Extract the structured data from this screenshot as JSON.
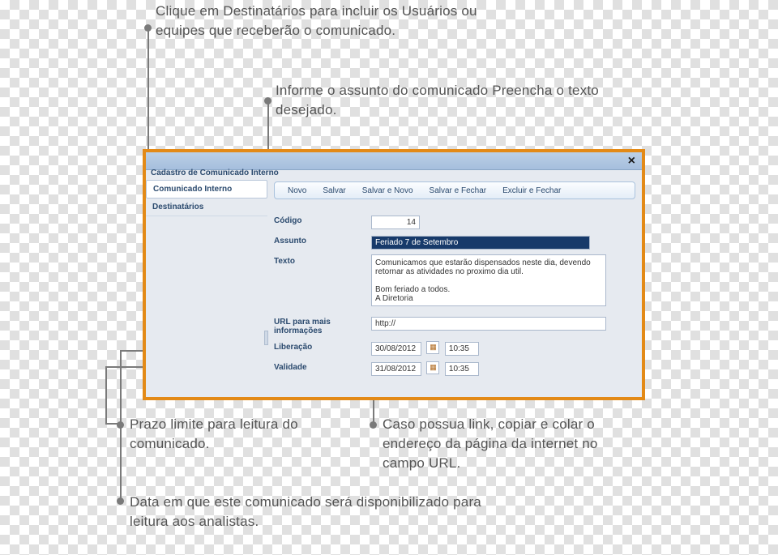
{
  "callouts": {
    "top1": "Clique em Destinatários para incluir os Usuários ou equipes que receberão o comunicado.",
    "top2": "Informe o assunto do comunicado Preencha o texto desejado.",
    "bottom_left": "Prazo limite para leitura do comunicado.",
    "bottom_right": "Caso possua link, copiar e colar o endereço da página da internet no campo URL.",
    "bottom2": "Data em que este comunicado será disponibilizado para leitura aos analistas."
  },
  "panel": {
    "title": "Cadastro de Comunicado Interno",
    "close": "×"
  },
  "sidebar": {
    "items": [
      "Comunicado Interno",
      "Destinatários"
    ]
  },
  "toolbar": {
    "novo": "Novo",
    "salvar": "Salvar",
    "salvar_novo": "Salvar e Novo",
    "salvar_fechar": "Salvar e Fechar",
    "excluir_fechar": "Excluir e Fechar"
  },
  "form": {
    "codigo_label": "Código",
    "codigo_value": "14",
    "assunto_label": "Assunto",
    "assunto_value": "Feriado 7 de Setembro",
    "texto_label": "Texto",
    "texto_value": "Comunicamos que estarão dispensados neste dia, devendo retornar as atividades no proximo dia util.\n\nBom feriado a todos.\nA Diretoria",
    "url_label": "URL para mais informações",
    "url_value": "http://",
    "liberacao_label": "Liberação",
    "liberacao_date": "30/08/2012",
    "liberacao_time": "10:35",
    "validade_label": "Validade",
    "validade_date": "31/08/2012",
    "validade_time": "10:35"
  }
}
